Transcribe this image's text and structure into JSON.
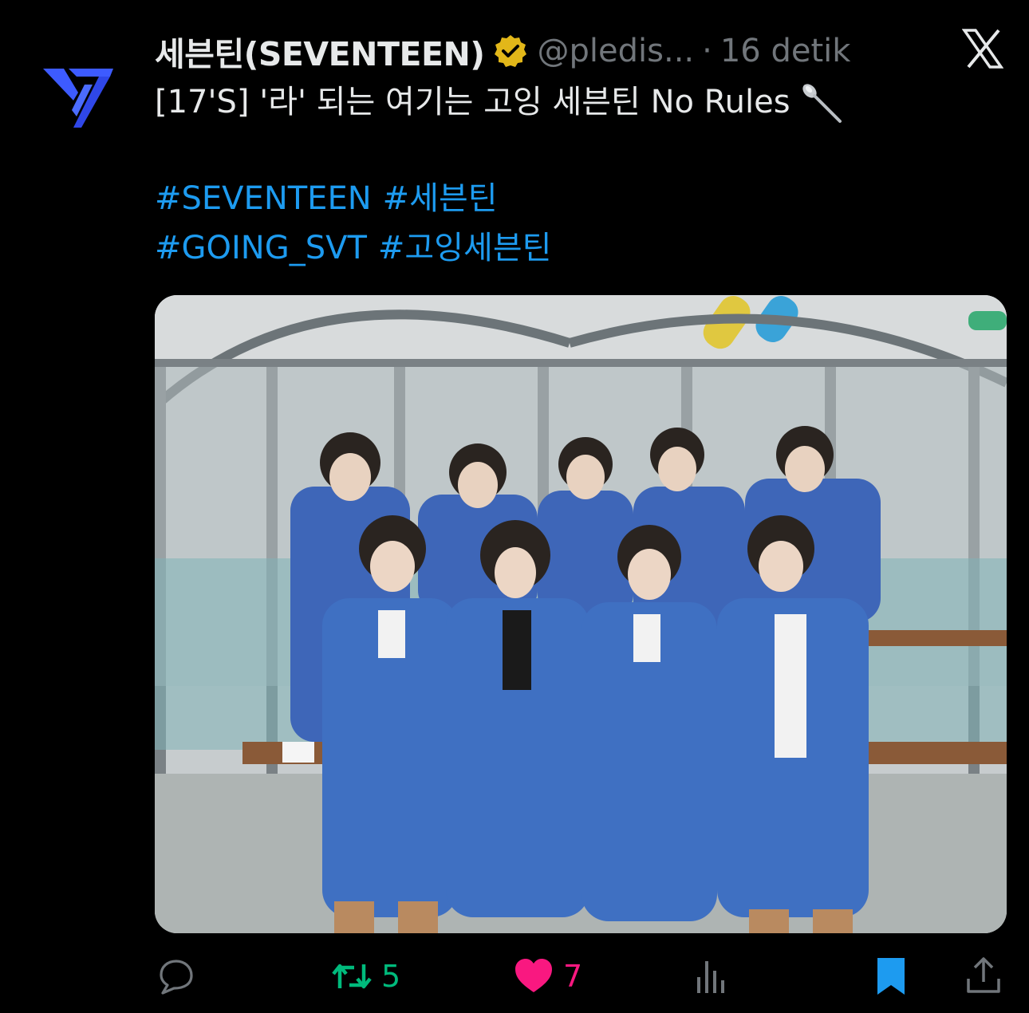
{
  "tweet": {
    "author": {
      "display_name": "세븐틴(SEVENTEEN)",
      "handle": "@pledis...",
      "verified_icon": "verified-gold-badge-icon",
      "avatar_icon": "seventeen-logo"
    },
    "separator": "·",
    "timestamp": "16 detik",
    "platform_icon": "x-logo-icon",
    "text": "[17'S] '라' 되는 여기는 고잉 세븐틴 No Rules",
    "emoji": "spoon-emoji",
    "hashtags_line1": [
      "#SEVENTEEN",
      "#세븐틴"
    ],
    "hashtags_line2": [
      "#GOING_SVT",
      "#고잉세븐틴"
    ],
    "media": {
      "type": "photo",
      "subject": "group of nine people in blue uniforms seated on benches behind chain-link fence"
    }
  },
  "actions": {
    "reply": {
      "icon": "reply-icon",
      "count": ""
    },
    "repost": {
      "icon": "repost-icon",
      "count": "5"
    },
    "like": {
      "icon": "heart-icon",
      "count": "7"
    },
    "views": {
      "icon": "views-icon",
      "count": ""
    },
    "bookmark": {
      "icon": "bookmark-icon",
      "count": ""
    },
    "share": {
      "icon": "share-icon"
    }
  },
  "colors": {
    "background": "#000000",
    "text": "#e7e9ea",
    "muted": "#71767b",
    "link": "#1d9bf0",
    "repost_active": "#00ba7c",
    "like_active": "#f91880",
    "bookmark_active": "#1d9bf0",
    "verified_gold": "#e2b719"
  }
}
